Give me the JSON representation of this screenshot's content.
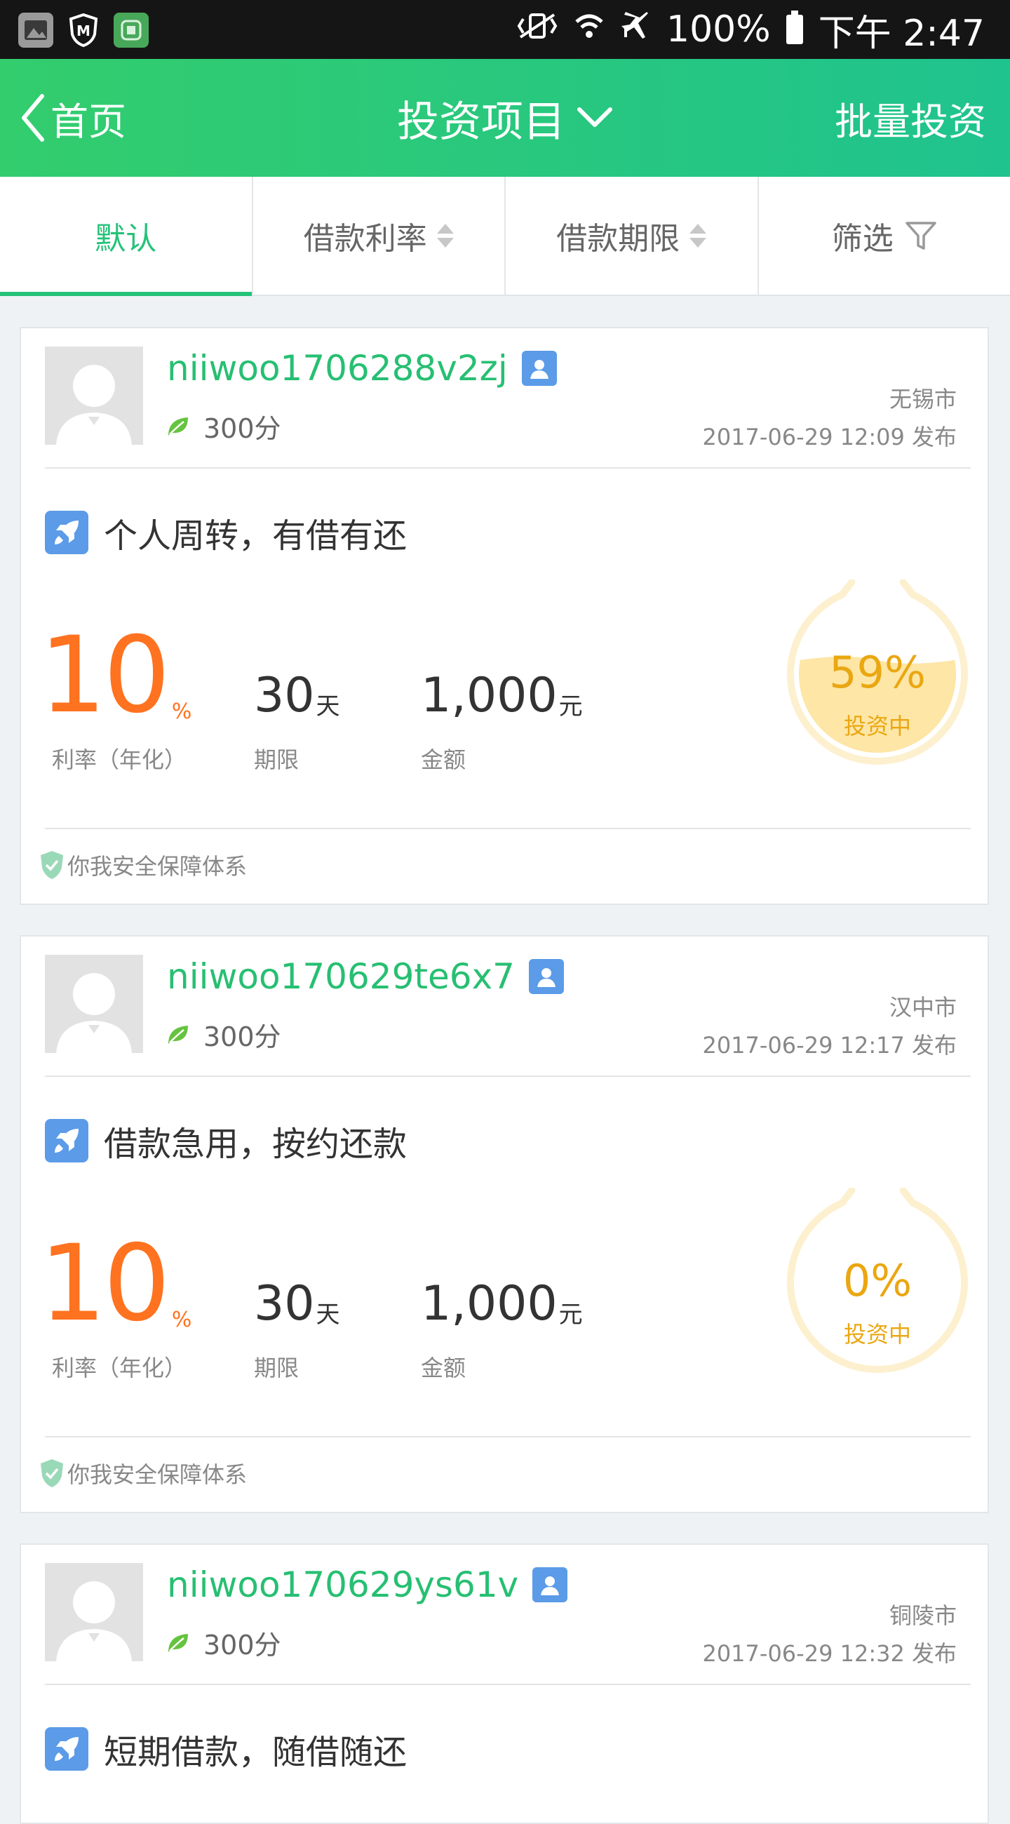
{
  "status_bar": {
    "battery_text": "100%",
    "time": "下午 2:47"
  },
  "header": {
    "back_label": "首页",
    "title": "投资项目",
    "batch_label": "批量投资",
    "accent_color": "#2ec77f"
  },
  "tabs": [
    {
      "label": "默认",
      "active": true
    },
    {
      "label": "借款利率",
      "sortable": true
    },
    {
      "label": "借款期限",
      "sortable": true
    },
    {
      "label": "筛选",
      "icon": "filter-icon"
    }
  ],
  "loans": [
    {
      "username": "niiwoo1706288v2zj",
      "score": "300分",
      "city": "无锡市",
      "published": "2017-06-29 12:09 发布",
      "purpose": "个人周转，有借有还",
      "rate": "10",
      "rate_unit": "%",
      "rate_label": "利率（年化）",
      "term": "30",
      "term_unit": "天",
      "term_label": "期限",
      "amount": "1,000",
      "amount_unit": "元",
      "amount_label": "金额",
      "progress_text": "59%",
      "progress_fraction": 0.59,
      "status": "投资中",
      "safety": "你我安全保障体系"
    },
    {
      "username": "niiwoo170629te6x7",
      "score": "300分",
      "city": "汉中市",
      "published": "2017-06-29 12:17 发布",
      "purpose": "借款急用，按约还款",
      "rate": "10",
      "rate_unit": "%",
      "rate_label": "利率（年化）",
      "term": "30",
      "term_unit": "天",
      "term_label": "期限",
      "amount": "1,000",
      "amount_unit": "元",
      "amount_label": "金额",
      "progress_text": "0%",
      "progress_fraction": 0.0,
      "status": "投资中",
      "safety": "你我安全保障体系"
    },
    {
      "username": "niiwoo170629ys61v",
      "score": "300分",
      "city": "铜陵市",
      "published": "2017-06-29 12:32 发布",
      "purpose": "短期借款，随借随还"
    }
  ]
}
